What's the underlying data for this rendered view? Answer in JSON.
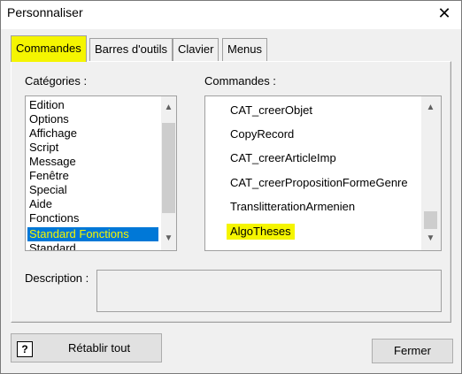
{
  "window": {
    "title": "Personnaliser",
    "close_glyph": "✕"
  },
  "tabs": [
    {
      "label": "Commandes",
      "active": true
    },
    {
      "label": "Barres d'outils",
      "active": false
    },
    {
      "label": "Clavier",
      "active": false
    },
    {
      "label": "Menus",
      "active": false
    }
  ],
  "categories": {
    "label": "Catégories :",
    "items": [
      "Edition",
      "Options",
      "Affichage",
      "Script",
      "Message",
      "Fenêtre",
      "Special",
      "Aide",
      "Fonctions",
      "Standard Fonctions",
      "Standard"
    ],
    "selected": "Standard Fonctions"
  },
  "commands": {
    "label": "Commandes :",
    "items": [
      "CAT_creerObjet",
      "CopyRecord",
      "CAT_creerArticleImp",
      "CAT_creerPropositionFormeGenre",
      "TranslitterationArmenien",
      "AlgoTheses"
    ],
    "highlighted": "AlgoTheses"
  },
  "description": {
    "label": "Description :",
    "value": ""
  },
  "buttons": {
    "help_glyph": "?",
    "reset_label": "Rétablir tout",
    "close_label": "Fermer"
  },
  "icons": [
    "close-icon",
    "help-icon",
    "scroll-up-icon",
    "scroll-down-icon"
  ],
  "colors": {
    "highlight": "#f5f500",
    "selection": "#0078d7",
    "background": "#f0f0f0"
  }
}
